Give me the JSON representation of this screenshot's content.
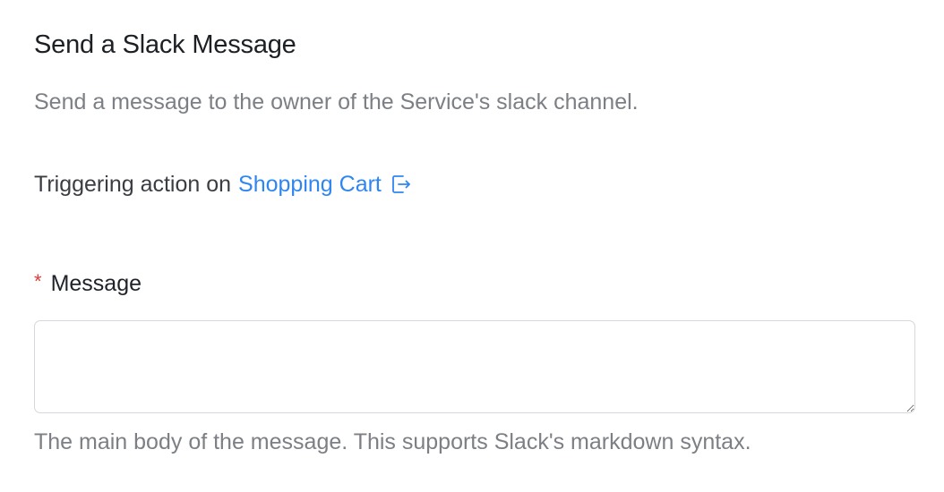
{
  "form": {
    "title": "Send a Slack Message",
    "description": "Send a message to the owner of the Service's slack channel.",
    "trigger": {
      "prefix": "Triggering action on",
      "entity_link": "Shopping Cart",
      "link_icon": "external-link-icon"
    },
    "fields": {
      "message": {
        "required_mark": "*",
        "label": "Message",
        "value": "",
        "placeholder": "",
        "helper": "The main body of the message. This supports Slack's markdown syntax."
      }
    }
  },
  "colors": {
    "link": "#2f86f0",
    "required": "#e03a3a",
    "muted_text": "#7c7f84",
    "input_border": "#d5d8dc"
  }
}
